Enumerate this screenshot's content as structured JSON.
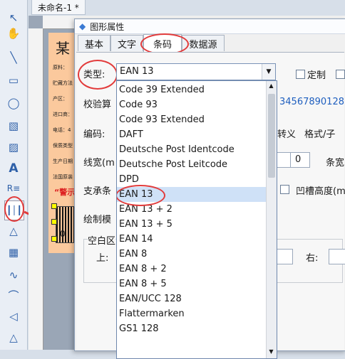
{
  "document_tab": {
    "title": "未命名-1 *"
  },
  "label_preview": {
    "brand_char": "某",
    "lines": [
      "原料：",
      "贮藏方法",
      "产区：",
      "进口商：",
      "电话：4",
      "保质类型",
      "生产日期",
      "法国原装"
    ],
    "warning": "“警示",
    "barcode_digit": "0"
  },
  "dialog": {
    "title": "图形属性",
    "tabs": [
      "基本",
      "文字",
      "条码",
      "数据源"
    ],
    "active_tab": "条码",
    "type_label": "类型:",
    "type_value": "EAN 13",
    "custom_label": "定制",
    "check_algo_label": "校验算",
    "check_value_partial": "34567890128",
    "encoding_label": "编码:",
    "escape_label": "转义",
    "format_label": "格式/子",
    "line_width_label": "线宽(m",
    "bar_width_label": "条宽",
    "bar_width_value": "0",
    "support_label": "支承条",
    "notch_height_label": "凹槽高度(m",
    "draw_mode_label": "绘制模",
    "blank_area_label": "空白区",
    "top_label": "上:",
    "right_label": "右:"
  },
  "dropdown_options": [
    "Code 39 Extended",
    "Code 93",
    "Code 93 Extended",
    "DAFT",
    "Deutsche Post Identcode",
    "Deutsche Post Leitcode",
    "DPD",
    "EAN 13",
    "EAN 13 + 2",
    "EAN 13 + 5",
    "EAN 14",
    "EAN 8",
    "EAN 8 + 2",
    "EAN 8 + 5",
    "EAN/UCC 128",
    "Flattermarken",
    "GS1 128"
  ],
  "selected_option": "EAN 13",
  "toolbar_icons": [
    "pointer-icon",
    "hand-icon",
    "line-icon",
    "rectangle-icon",
    "ellipse-icon",
    "image-icon",
    "picture-icon",
    "text-icon",
    "rich-text-icon",
    "barcode-icon",
    "shape-icon",
    "qrcode-icon",
    "curve-icon",
    "arc-icon",
    "polygon-icon",
    "triangle-icon"
  ],
  "colors": {
    "highlight_ellipse": "#e23b3b",
    "selection": "#cfe1f7",
    "link_blue": "#1f5fbf"
  }
}
